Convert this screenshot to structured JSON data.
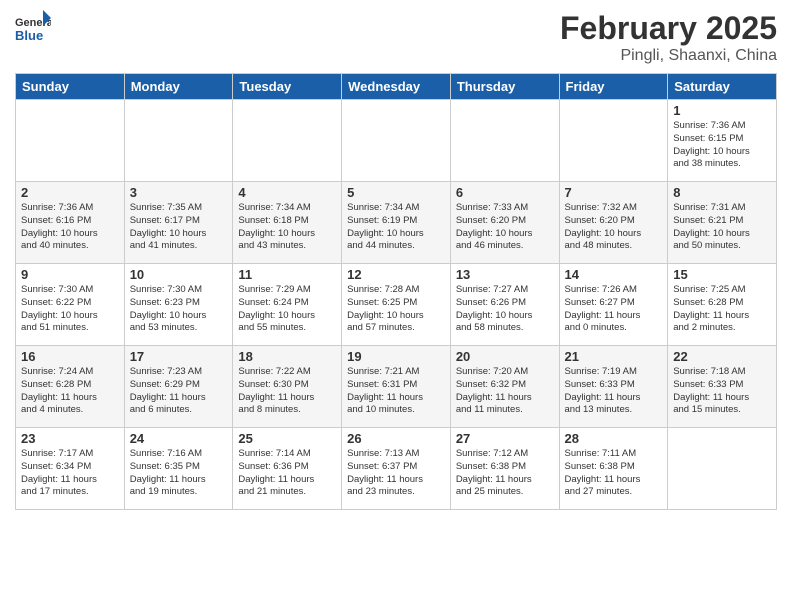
{
  "header": {
    "logo_line1": "General",
    "logo_line2": "Blue",
    "month_year": "February 2025",
    "location": "Pingli, Shaanxi, China"
  },
  "days_of_week": [
    "Sunday",
    "Monday",
    "Tuesday",
    "Wednesday",
    "Thursday",
    "Friday",
    "Saturday"
  ],
  "weeks": [
    [
      {
        "day": "",
        "info": ""
      },
      {
        "day": "",
        "info": ""
      },
      {
        "day": "",
        "info": ""
      },
      {
        "day": "",
        "info": ""
      },
      {
        "day": "",
        "info": ""
      },
      {
        "day": "",
        "info": ""
      },
      {
        "day": "1",
        "info": "Sunrise: 7:36 AM\nSunset: 6:15 PM\nDaylight: 10 hours\nand 38 minutes."
      }
    ],
    [
      {
        "day": "2",
        "info": "Sunrise: 7:36 AM\nSunset: 6:16 PM\nDaylight: 10 hours\nand 40 minutes."
      },
      {
        "day": "3",
        "info": "Sunrise: 7:35 AM\nSunset: 6:17 PM\nDaylight: 10 hours\nand 41 minutes."
      },
      {
        "day": "4",
        "info": "Sunrise: 7:34 AM\nSunset: 6:18 PM\nDaylight: 10 hours\nand 43 minutes."
      },
      {
        "day": "5",
        "info": "Sunrise: 7:34 AM\nSunset: 6:19 PM\nDaylight: 10 hours\nand 44 minutes."
      },
      {
        "day": "6",
        "info": "Sunrise: 7:33 AM\nSunset: 6:20 PM\nDaylight: 10 hours\nand 46 minutes."
      },
      {
        "day": "7",
        "info": "Sunrise: 7:32 AM\nSunset: 6:20 PM\nDaylight: 10 hours\nand 48 minutes."
      },
      {
        "day": "8",
        "info": "Sunrise: 7:31 AM\nSunset: 6:21 PM\nDaylight: 10 hours\nand 50 minutes."
      }
    ],
    [
      {
        "day": "9",
        "info": "Sunrise: 7:30 AM\nSunset: 6:22 PM\nDaylight: 10 hours\nand 51 minutes."
      },
      {
        "day": "10",
        "info": "Sunrise: 7:30 AM\nSunset: 6:23 PM\nDaylight: 10 hours\nand 53 minutes."
      },
      {
        "day": "11",
        "info": "Sunrise: 7:29 AM\nSunset: 6:24 PM\nDaylight: 10 hours\nand 55 minutes."
      },
      {
        "day": "12",
        "info": "Sunrise: 7:28 AM\nSunset: 6:25 PM\nDaylight: 10 hours\nand 57 minutes."
      },
      {
        "day": "13",
        "info": "Sunrise: 7:27 AM\nSunset: 6:26 PM\nDaylight: 10 hours\nand 58 minutes."
      },
      {
        "day": "14",
        "info": "Sunrise: 7:26 AM\nSunset: 6:27 PM\nDaylight: 11 hours\nand 0 minutes."
      },
      {
        "day": "15",
        "info": "Sunrise: 7:25 AM\nSunset: 6:28 PM\nDaylight: 11 hours\nand 2 minutes."
      }
    ],
    [
      {
        "day": "16",
        "info": "Sunrise: 7:24 AM\nSunset: 6:28 PM\nDaylight: 11 hours\nand 4 minutes."
      },
      {
        "day": "17",
        "info": "Sunrise: 7:23 AM\nSunset: 6:29 PM\nDaylight: 11 hours\nand 6 minutes."
      },
      {
        "day": "18",
        "info": "Sunrise: 7:22 AM\nSunset: 6:30 PM\nDaylight: 11 hours\nand 8 minutes."
      },
      {
        "day": "19",
        "info": "Sunrise: 7:21 AM\nSunset: 6:31 PM\nDaylight: 11 hours\nand 10 minutes."
      },
      {
        "day": "20",
        "info": "Sunrise: 7:20 AM\nSunset: 6:32 PM\nDaylight: 11 hours\nand 11 minutes."
      },
      {
        "day": "21",
        "info": "Sunrise: 7:19 AM\nSunset: 6:33 PM\nDaylight: 11 hours\nand 13 minutes."
      },
      {
        "day": "22",
        "info": "Sunrise: 7:18 AM\nSunset: 6:33 PM\nDaylight: 11 hours\nand 15 minutes."
      }
    ],
    [
      {
        "day": "23",
        "info": "Sunrise: 7:17 AM\nSunset: 6:34 PM\nDaylight: 11 hours\nand 17 minutes."
      },
      {
        "day": "24",
        "info": "Sunrise: 7:16 AM\nSunset: 6:35 PM\nDaylight: 11 hours\nand 19 minutes."
      },
      {
        "day": "25",
        "info": "Sunrise: 7:14 AM\nSunset: 6:36 PM\nDaylight: 11 hours\nand 21 minutes."
      },
      {
        "day": "26",
        "info": "Sunrise: 7:13 AM\nSunset: 6:37 PM\nDaylight: 11 hours\nand 23 minutes."
      },
      {
        "day": "27",
        "info": "Sunrise: 7:12 AM\nSunset: 6:38 PM\nDaylight: 11 hours\nand 25 minutes."
      },
      {
        "day": "28",
        "info": "Sunrise: 7:11 AM\nSunset: 6:38 PM\nDaylight: 11 hours\nand 27 minutes."
      },
      {
        "day": "",
        "info": ""
      }
    ]
  ]
}
